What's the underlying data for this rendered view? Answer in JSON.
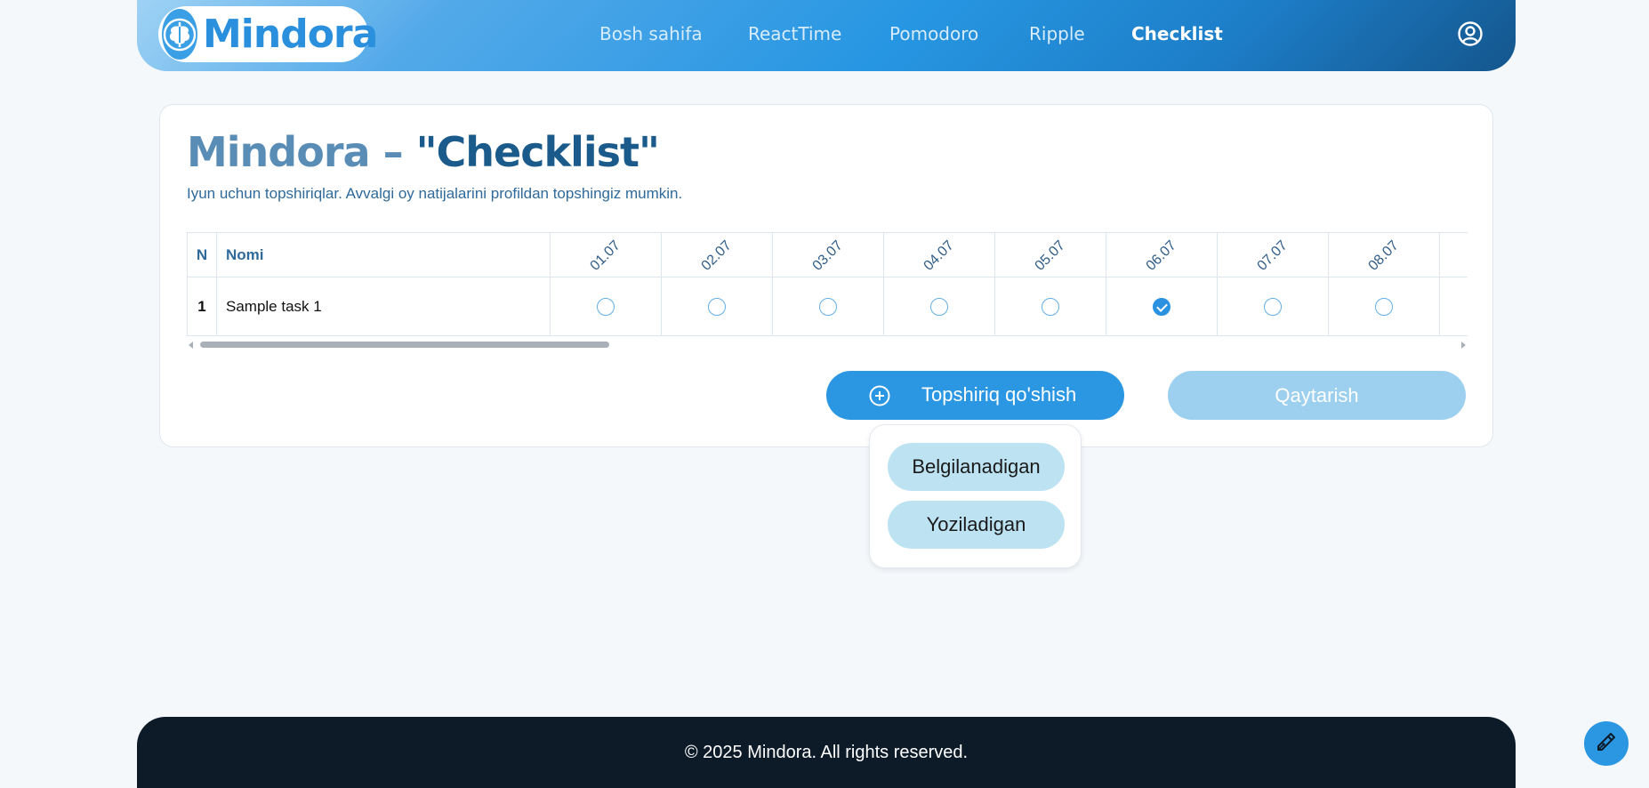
{
  "brand": {
    "name": "Mindora"
  },
  "nav": {
    "items": [
      {
        "label": "Bosh sahifa",
        "active": false
      },
      {
        "label": "ReactTime",
        "active": false
      },
      {
        "label": "Pomodoro",
        "active": false
      },
      {
        "label": "Ripple",
        "active": false
      },
      {
        "label": "Checklist",
        "active": true
      }
    ],
    "profile_icon": "user-circle-icon"
  },
  "page": {
    "title_part1": "Mindora – ",
    "title_part2": "\"Checklist\"",
    "subtitle": "Iyun uchun topshiriqlar. Avvalgi oy natijalarini profildan topshingiz mumkin."
  },
  "table": {
    "col_n": "N",
    "col_name": "Nomi",
    "dates": [
      "01.07",
      "02.07",
      "03.07",
      "04.07",
      "05.07",
      "06.07",
      "07.07",
      "08.07"
    ],
    "rows": [
      {
        "n": "1",
        "name": "Sample task 1",
        "checks": [
          false,
          false,
          false,
          false,
          false,
          true,
          false,
          false
        ]
      }
    ]
  },
  "actions": {
    "add_label": "Topshiriq qo'shish",
    "back_label": "Qaytarish"
  },
  "dropdown": {
    "items": [
      "Belgilanadigan",
      "Yoziladigan"
    ]
  },
  "footer": {
    "text": "© 2025 Mindora. All rights reserved."
  },
  "colors": {
    "primary": "#2b97e3",
    "primary_light": "#9dcfef",
    "dropdown_item": "#bde3f3",
    "title_dark": "#1b5b8c",
    "title_light": "#5a8db6",
    "footer_bg": "#0d1b29"
  }
}
